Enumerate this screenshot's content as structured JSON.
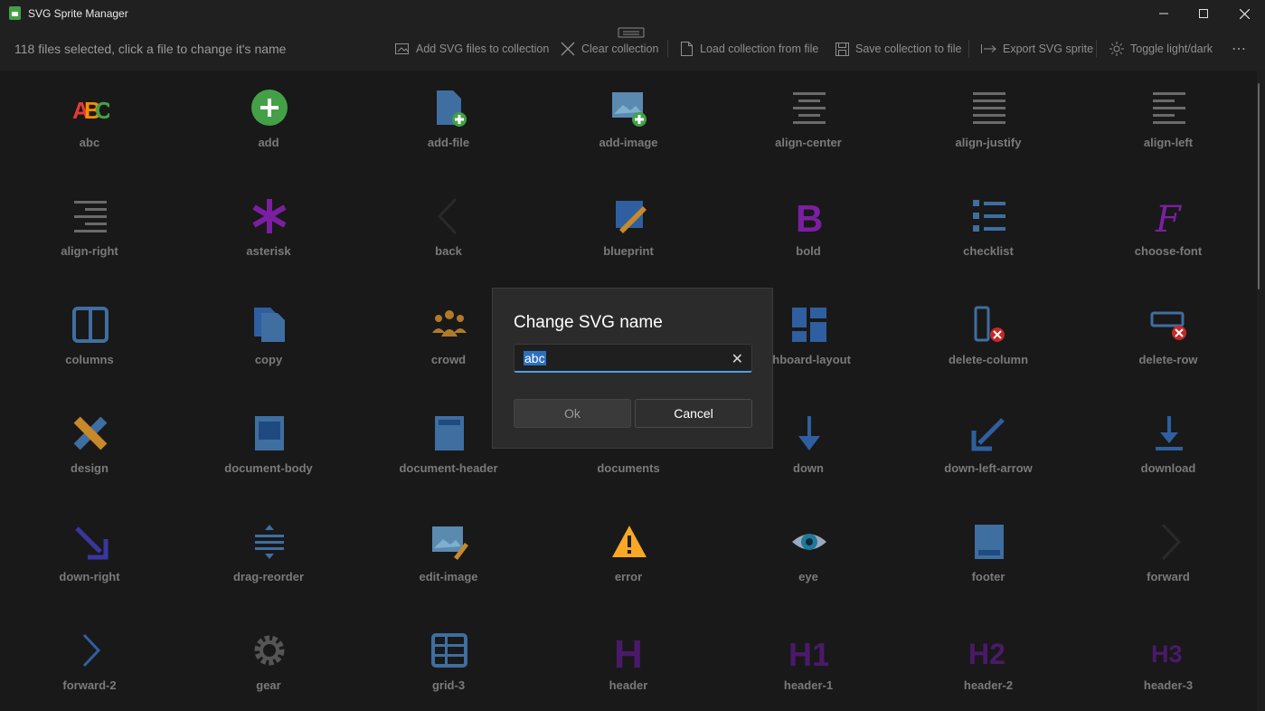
{
  "window": {
    "title": "SVG Sprite Manager"
  },
  "toolbar": {
    "selection_text": "118 files selected, click a file to change it's name",
    "add_label": "Add SVG files to collection",
    "clear_label": "Clear collection",
    "load_label": "Load collection from file",
    "save_label": "Save collection to file",
    "export_label": "Export SVG sprite",
    "toggle_label": "Toggle light/dark",
    "more_label": "⋯"
  },
  "icons": [
    {
      "label": "abc",
      "icon": "abc-icon"
    },
    {
      "label": "add",
      "icon": "add-icon"
    },
    {
      "label": "add-file",
      "icon": "add-file-icon"
    },
    {
      "label": "add-image",
      "icon": "add-image-icon"
    },
    {
      "label": "align-center",
      "icon": "align-center-icon"
    },
    {
      "label": "align-justify",
      "icon": "align-justify-icon"
    },
    {
      "label": "align-left",
      "icon": "align-left-icon"
    },
    {
      "label": "align-right",
      "icon": "align-right-icon"
    },
    {
      "label": "asterisk",
      "icon": "asterisk-icon"
    },
    {
      "label": "back",
      "icon": "back-icon"
    },
    {
      "label": "blueprint",
      "icon": "blueprint-icon"
    },
    {
      "label": "bold",
      "icon": "bold-icon"
    },
    {
      "label": "checklist",
      "icon": "checklist-icon"
    },
    {
      "label": "choose-font",
      "icon": "choose-font-icon"
    },
    {
      "label": "columns",
      "icon": "columns-icon"
    },
    {
      "label": "copy",
      "icon": "copy-icon"
    },
    {
      "label": "crowd",
      "icon": "crowd-icon"
    },
    {
      "label": "",
      "icon": "hidden-icon"
    },
    {
      "label": "shboard-layout",
      "icon": "dashboard-layout-icon"
    },
    {
      "label": "delete-column",
      "icon": "delete-column-icon"
    },
    {
      "label": "delete-row",
      "icon": "delete-row-icon"
    },
    {
      "label": "design",
      "icon": "design-icon"
    },
    {
      "label": "document-body",
      "icon": "document-body-icon"
    },
    {
      "label": "document-header",
      "icon": "document-header-icon"
    },
    {
      "label": "documents",
      "icon": "documents-icon"
    },
    {
      "label": "down",
      "icon": "down-icon"
    },
    {
      "label": "down-left-arrow",
      "icon": "down-left-arrow-icon"
    },
    {
      "label": "download",
      "icon": "download-icon"
    },
    {
      "label": "down-right",
      "icon": "down-right-icon"
    },
    {
      "label": "drag-reorder",
      "icon": "drag-reorder-icon"
    },
    {
      "label": "edit-image",
      "icon": "edit-image-icon"
    },
    {
      "label": "error",
      "icon": "error-icon"
    },
    {
      "label": "eye",
      "icon": "eye-icon"
    },
    {
      "label": "footer",
      "icon": "footer-icon"
    },
    {
      "label": "forward",
      "icon": "forward-icon"
    },
    {
      "label": "forward-2",
      "icon": "forward-2-icon"
    },
    {
      "label": "gear",
      "icon": "gear-icon"
    },
    {
      "label": "grid-3",
      "icon": "grid-3-icon"
    },
    {
      "label": "header",
      "icon": "header-icon"
    },
    {
      "label": "header-1",
      "icon": "header-1-icon"
    },
    {
      "label": "header-2",
      "icon": "header-2-icon"
    },
    {
      "label": "header-3",
      "icon": "header-3-icon"
    }
  ],
  "dialog": {
    "title": "Change SVG name",
    "input_value": "abc",
    "ok_label": "Ok",
    "cancel_label": "Cancel"
  },
  "colors": {
    "accent": "#4c9fe8",
    "selection": "#2d6fbf"
  }
}
